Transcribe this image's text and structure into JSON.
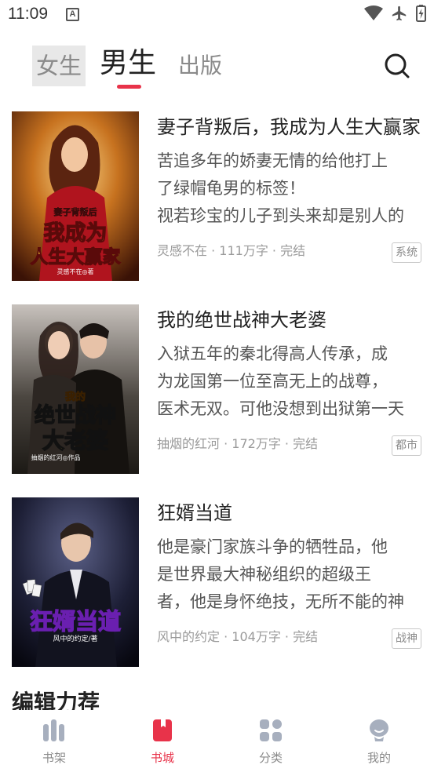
{
  "status_bar": {
    "time": "11:09",
    "notification": "A"
  },
  "top_tabs": {
    "female": "女生",
    "male": "男生",
    "publish": "出版",
    "active_color": "#e8334a"
  },
  "books": [
    {
      "title": "妻子背叛后，我成为人生大赢家",
      "desc": [
        "苦追多年的娇妻无情的给他打上",
        "了绿帽龟男的标签！",
        "视若珍宝的儿子到头来却是别人的"
      ],
      "author": "灵感不在",
      "words": "111万字",
      "status": "完结",
      "tag": "系统",
      "cover_text": {
        "small": "妻子背叛后",
        "big1": "我成为",
        "big2": "人生大赢家",
        "author": "灵感不在◎著"
      }
    },
    {
      "title": "我的绝世战神大老婆",
      "desc": [
        "入狱五年的秦北得高人传承，成",
        "为龙国第一位至高无上的战尊，",
        "医术无双。可他没想到出狱第一天"
      ],
      "author": "抽烟的红河",
      "words": "172万字",
      "status": "完结",
      "tag": "都市",
      "cover_text": {
        "small": "我的",
        "big1": "绝世战神",
        "big2": "大老婆",
        "author": "抽烟的红河◎作品"
      }
    },
    {
      "title": "狂婿当道",
      "desc": [
        "他是豪门家族斗争的牺牲品，他",
        "是世界最大神秘组织的超级王",
        "者，他是身怀绝技，无所不能的神"
      ],
      "author": "风中的约定",
      "words": "104万字",
      "status": "完结",
      "tag": "战神",
      "cover_text": {
        "small": "",
        "big1": "狂婿当道",
        "big2": "",
        "author": "风中的约定/著"
      }
    }
  ],
  "section_peek": "编辑力荐",
  "bottom_nav": [
    {
      "label": "书架",
      "icon": "bookshelf-icon",
      "active": false
    },
    {
      "label": "书城",
      "icon": "bookstore-icon",
      "active": true
    },
    {
      "label": "分类",
      "icon": "category-icon",
      "active": false
    },
    {
      "label": "我的",
      "icon": "profile-icon",
      "active": false
    }
  ]
}
